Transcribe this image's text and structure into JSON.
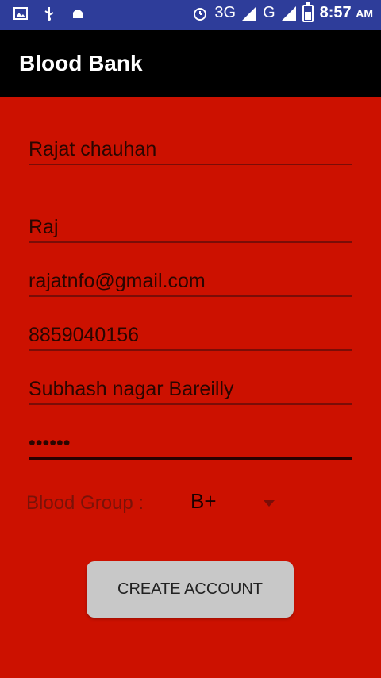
{
  "status_bar": {
    "network_3g": "3G",
    "network_g": "G",
    "time": "8:57",
    "ampm": "AM"
  },
  "app": {
    "title": "Blood Bank"
  },
  "form": {
    "full_name": "Rajat chauhan",
    "username": "Raj",
    "email": "rajatnfo@gmail.com",
    "phone": "8859040156",
    "address": "Subhash nagar Bareilly",
    "password": "••••••",
    "blood_group_label": "Blood Group :",
    "blood_group_value": "B+"
  },
  "actions": {
    "create_account": "CREATE ACCOUNT"
  },
  "colors": {
    "background": "#cc1100",
    "app_bar": "#000000",
    "status_bar": "#2e3d9a",
    "button": "#c8c8c8"
  }
}
